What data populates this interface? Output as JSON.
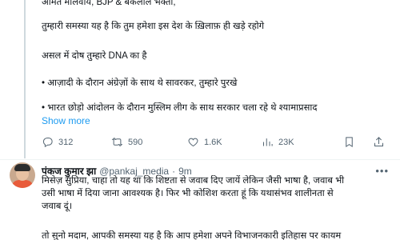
{
  "first_tweet": {
    "lines": [
      "अमित मालवीय, BJP & बकलोल भक्तों,",
      "तुम्हारी समस्या यह है कि तुम हमेशा इस देश के ख़िलाफ़ ही खड़े रहोगे",
      "असल में दोष तुम्हारे DNA का है",
      "• आज़ादी के दौरान अंग्रेज़ों के साथ थे सावरकर, तुम्हारे पुरखे",
      "• भारत छोड़ो आंदोलन के दौरान मुस्लिम लीग के साथ सरकार चला रहे थे श्यामाप्रसाद"
    ],
    "show_more": "Show more",
    "actions": {
      "replies": "312",
      "reposts": "590",
      "likes": "1.6K",
      "views": "23K"
    }
  },
  "second_tweet": {
    "display_name": "पंकज कुमार झा",
    "handle": "@pankaj_media",
    "separator": "·",
    "time": "9m",
    "lines": [
      "मिसेज़ सुप्रिया, चाहा तो यह था कि शिष्टता से जवाब दिए जायें लेकिन जैसी भाषा है, जवाब भी",
      "उसी भाषा में दिया जाना आवश्यक है। फिर भी कोशिश करता हूं कि यथासंभव शालीनता से",
      "जवाब दूं।",
      "तो सुनो मदाम, आपकी समस्या यह है कि आप हमेशा अपने विभाजनकारी इतिहास पर कायम"
    ]
  },
  "icons": {
    "reply": "reply-icon",
    "repost": "repost-icon",
    "like": "heart-icon",
    "views": "views-icon",
    "bookmark": "bookmark-icon",
    "share": "share-icon",
    "more": "more-icon"
  },
  "colors": {
    "link": "#1d9bf0",
    "secondary_text": "#536471",
    "divider": "#eff3f4"
  }
}
